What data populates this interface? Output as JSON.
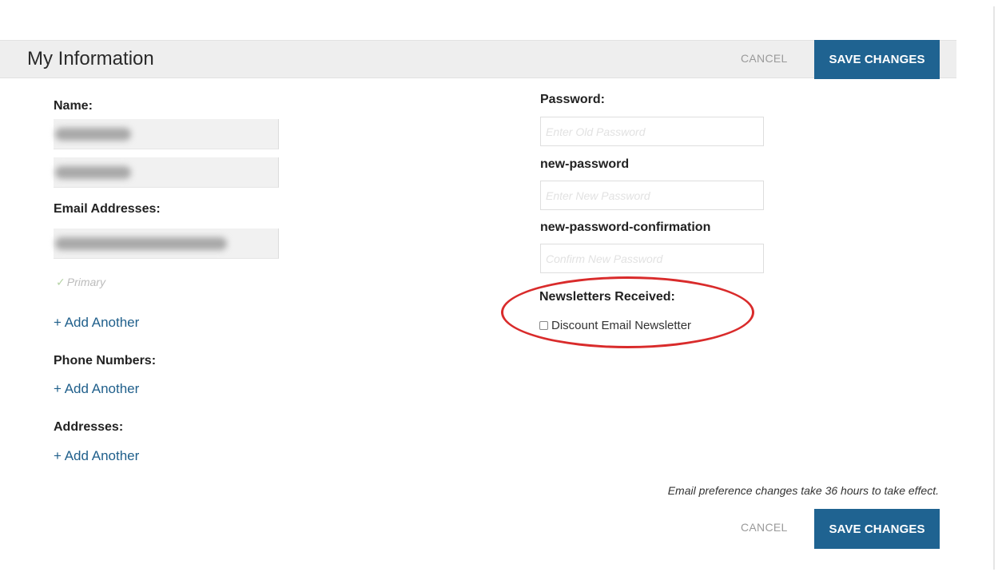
{
  "header": {
    "title": "My Information",
    "cancel_label": "CANCEL",
    "save_label": "SAVE CHANGES"
  },
  "left": {
    "name_label": "Name:",
    "email_label": "Email Addresses:",
    "primary_label": "Primary",
    "add_another_email": "+ Add Another",
    "phone_label": "Phone Numbers:",
    "add_another_phone": "+ Add Another",
    "address_label": "Addresses:",
    "add_another_address": "+ Add Another"
  },
  "right": {
    "password_label": "Password:",
    "password_placeholder": "Enter Old Password",
    "new_password_label": "new-password",
    "new_password_placeholder": "Enter New Password",
    "new_password_confirm_label": "new-password-confirmation",
    "new_password_confirm_placeholder": "Confirm New Password",
    "newsletters_label": "Newsletters Received:",
    "newsletter_option": "Discount Email Newsletter",
    "newsletter_checked": false
  },
  "footer": {
    "note": "Email preference changes take 36 hours to take effect.",
    "cancel_label": "CANCEL",
    "save_label": "SAVE CHANGES"
  },
  "colors": {
    "primary_button": "#1f6391",
    "link": "#1f5f8b",
    "annotation": "#d92b2b"
  }
}
